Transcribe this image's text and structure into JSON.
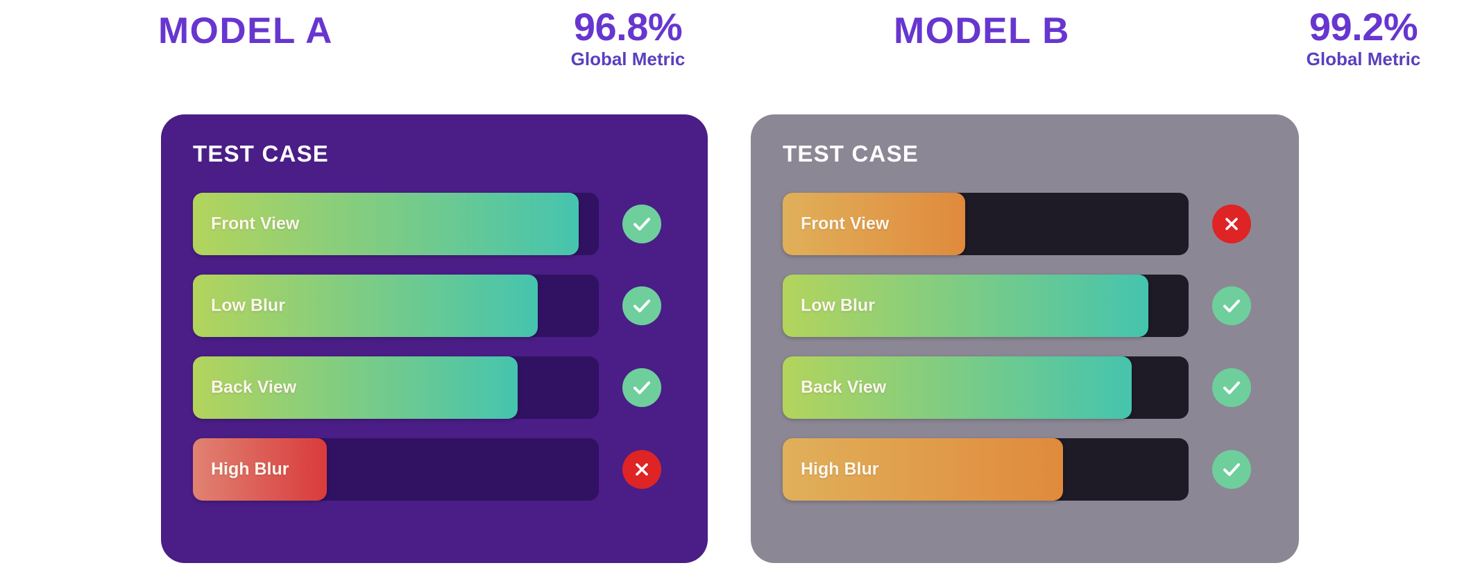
{
  "colors": {
    "page_background": "#ffffff",
    "heading_purple": "#6736cf",
    "card_a_background": "#4a1e86",
    "card_b_background": "#8c8795",
    "track_a": "#311162",
    "track_b": "#1e1a26",
    "pass_green": "#6ecf9c",
    "fail_red": "#de2424",
    "green_gradient_start": "#b3d45c",
    "green_gradient_end": "#45c4ae",
    "orange_gradient_start": "#e0b05a",
    "orange_gradient_end": "#e08a3c",
    "red_gradient_start": "#e08272",
    "red_gradient_end": "#d93b3b"
  },
  "panels": [
    {
      "model_name": "MODEL A",
      "metric_value": "96.8%",
      "metric_label": "Global Metric",
      "card_title": "TEST CASE",
      "rows": [
        {
          "label": "Front View",
          "percent": 95,
          "status": "pass",
          "fill_style": "green"
        },
        {
          "label": "Low Blur",
          "percent": 85,
          "status": "pass",
          "fill_style": "green"
        },
        {
          "label": "Back View",
          "percent": 80,
          "status": "pass",
          "fill_style": "green"
        },
        {
          "label": "High Blur",
          "percent": 33,
          "status": "fail",
          "fill_style": "red"
        }
      ]
    },
    {
      "model_name": "MODEL B",
      "metric_value": "99.2%",
      "metric_label": "Global Metric",
      "card_title": "TEST CASE",
      "rows": [
        {
          "label": "Front View",
          "percent": 45,
          "status": "fail",
          "fill_style": "orange"
        },
        {
          "label": "Low Blur",
          "percent": 90,
          "status": "pass",
          "fill_style": "green"
        },
        {
          "label": "Back View",
          "percent": 86,
          "status": "pass",
          "fill_style": "green"
        },
        {
          "label": "High Blur",
          "percent": 69,
          "status": "pass",
          "fill_style": "orange"
        }
      ]
    }
  ],
  "chart_data": {
    "type": "bar",
    "title": "Model A vs Model B test case comparison",
    "categories": [
      "Front View",
      "Low Blur",
      "Back View",
      "High Blur"
    ],
    "series": [
      {
        "name": "MODEL A",
        "values": [
          95,
          85,
          80,
          33
        ],
        "statuses": [
          "pass",
          "pass",
          "pass",
          "fail"
        ]
      },
      {
        "name": "MODEL B",
        "values": [
          45,
          90,
          86,
          69
        ],
        "statuses": [
          "fail",
          "pass",
          "pass",
          "pass"
        ]
      }
    ],
    "summary_metrics": [
      {
        "name": "MODEL A",
        "label": "Global Metric",
        "value": 96.8,
        "display": "96.8%"
      },
      {
        "name": "MODEL B",
        "label": "Global Metric",
        "value": 99.2,
        "display": "99.2%"
      }
    ],
    "xlabel": "",
    "ylabel": "",
    "ylim": [
      0,
      100
    ],
    "grid": false,
    "legend": "none",
    "orientation": "horizontal"
  }
}
